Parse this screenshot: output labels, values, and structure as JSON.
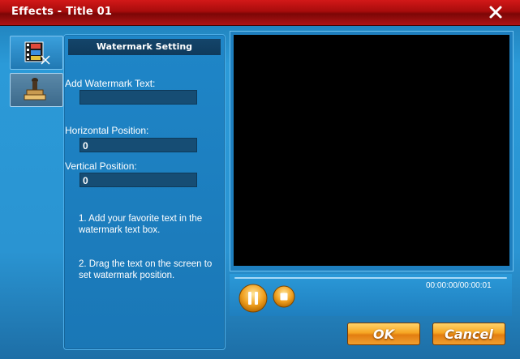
{
  "window": {
    "title": "Effects - Title 01"
  },
  "tabs": [
    {
      "name": "video-effects",
      "icon": "film-icon"
    },
    {
      "name": "watermark",
      "icon": "stamp-icon"
    }
  ],
  "watermark_panel": {
    "header": "Watermark Setting",
    "text_label": "Add Watermark Text:",
    "text_value": "",
    "horizontal_label": "Horizontal Position:",
    "horizontal_value": "0",
    "vertical_label": "Vertical Position:",
    "vertical_value": "0",
    "instruction_1": "1. Add your favorite text in the watermark text box.",
    "instruction_2": "2. Drag the text on  the screen to set watermark position."
  },
  "player": {
    "timecode": "00:00:00/00:00:01"
  },
  "buttons": {
    "ok": "OK",
    "cancel": "Cancel"
  },
  "colors": {
    "titlebar": "#b01414",
    "panel": "#1f86c8",
    "button": "#f6a623"
  }
}
